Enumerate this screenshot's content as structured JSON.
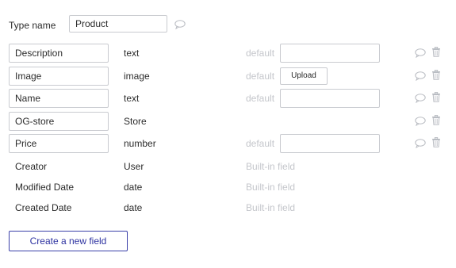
{
  "header": {
    "type_label": "Type name",
    "type_value": "Product"
  },
  "fields": [
    {
      "name": "Description",
      "type": "text",
      "default_label": "default",
      "control": "input",
      "editable": true
    },
    {
      "name": "Image",
      "type": "image",
      "default_label": "default",
      "control": "upload",
      "upload_label": "Upload",
      "editable": true
    },
    {
      "name": "Name",
      "type": "text",
      "default_label": "default",
      "control": "input",
      "editable": true
    },
    {
      "name": "OG-store",
      "type": "Store",
      "default_label": "",
      "control": "none",
      "editable": true
    },
    {
      "name": "Price",
      "type": "number",
      "default_label": "default",
      "control": "input",
      "editable": true
    },
    {
      "name": "Creator",
      "type": "User",
      "default_label": "Built-in field",
      "control": "none",
      "editable": false
    },
    {
      "name": "Modified Date",
      "type": "date",
      "default_label": "Built-in field",
      "control": "none",
      "editable": false
    },
    {
      "name": "Created Date",
      "type": "date",
      "default_label": "Built-in field",
      "control": "none",
      "editable": false
    }
  ],
  "footer": {
    "create_label": "Create a new field"
  },
  "icons": {
    "comment": "comment-icon",
    "trash": "trash-icon"
  },
  "colors": {
    "accent": "#2c31a0",
    "muted_text": "#c4c6cb",
    "border": "#c9cbd0",
    "icon": "#b9bcc2"
  }
}
